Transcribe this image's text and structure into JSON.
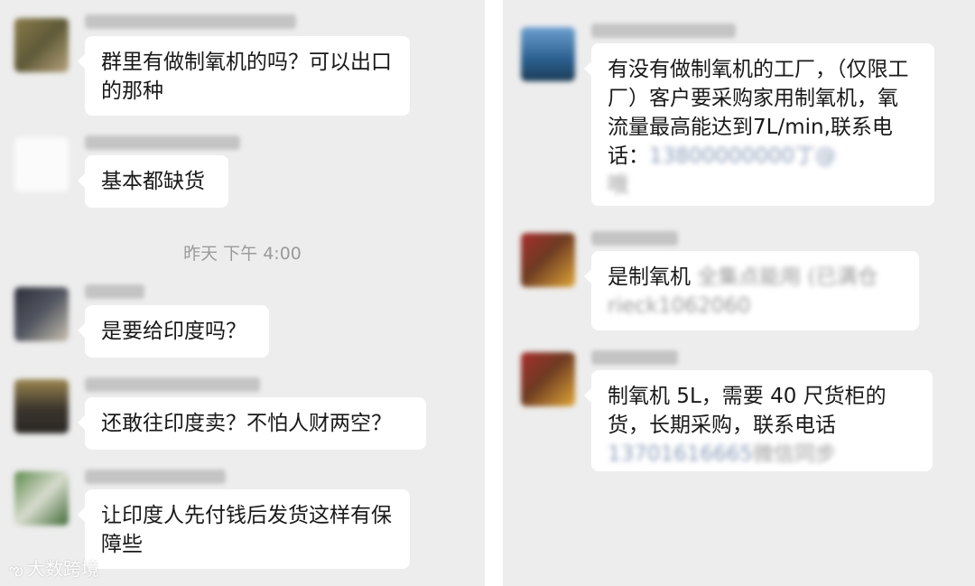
{
  "left_panel": {
    "messages": [
      {
        "text": "群里有做制氧机的吗？可以出口的那种"
      },
      {
        "text": "基本都缺货"
      },
      {
        "text": "是要给印度吗？"
      },
      {
        "text": "还敢往印度卖？不怕人财两空？"
      },
      {
        "text": "让印度人先付钱后发货这样有保障些"
      }
    ],
    "timestamp": "昨天 下午 4:00"
  },
  "right_panel": {
    "messages": [
      {
        "text": "有没有做制氧机的工厂，（仅限工厂）客户要采购家用制氧机，氧流量最高能达到7L/min,联系电话："
      },
      {
        "text": "是制氧机"
      },
      {
        "text": "制氧机 5L，需要 40 尺货柜的货，长期采购，联系电话"
      }
    ]
  },
  "watermark": {
    "text": "大数跨境"
  },
  "colors": {
    "background": "#ededed",
    "bubble": "#ffffff",
    "text": "#191919",
    "timestamp": "#9a9a9a"
  }
}
